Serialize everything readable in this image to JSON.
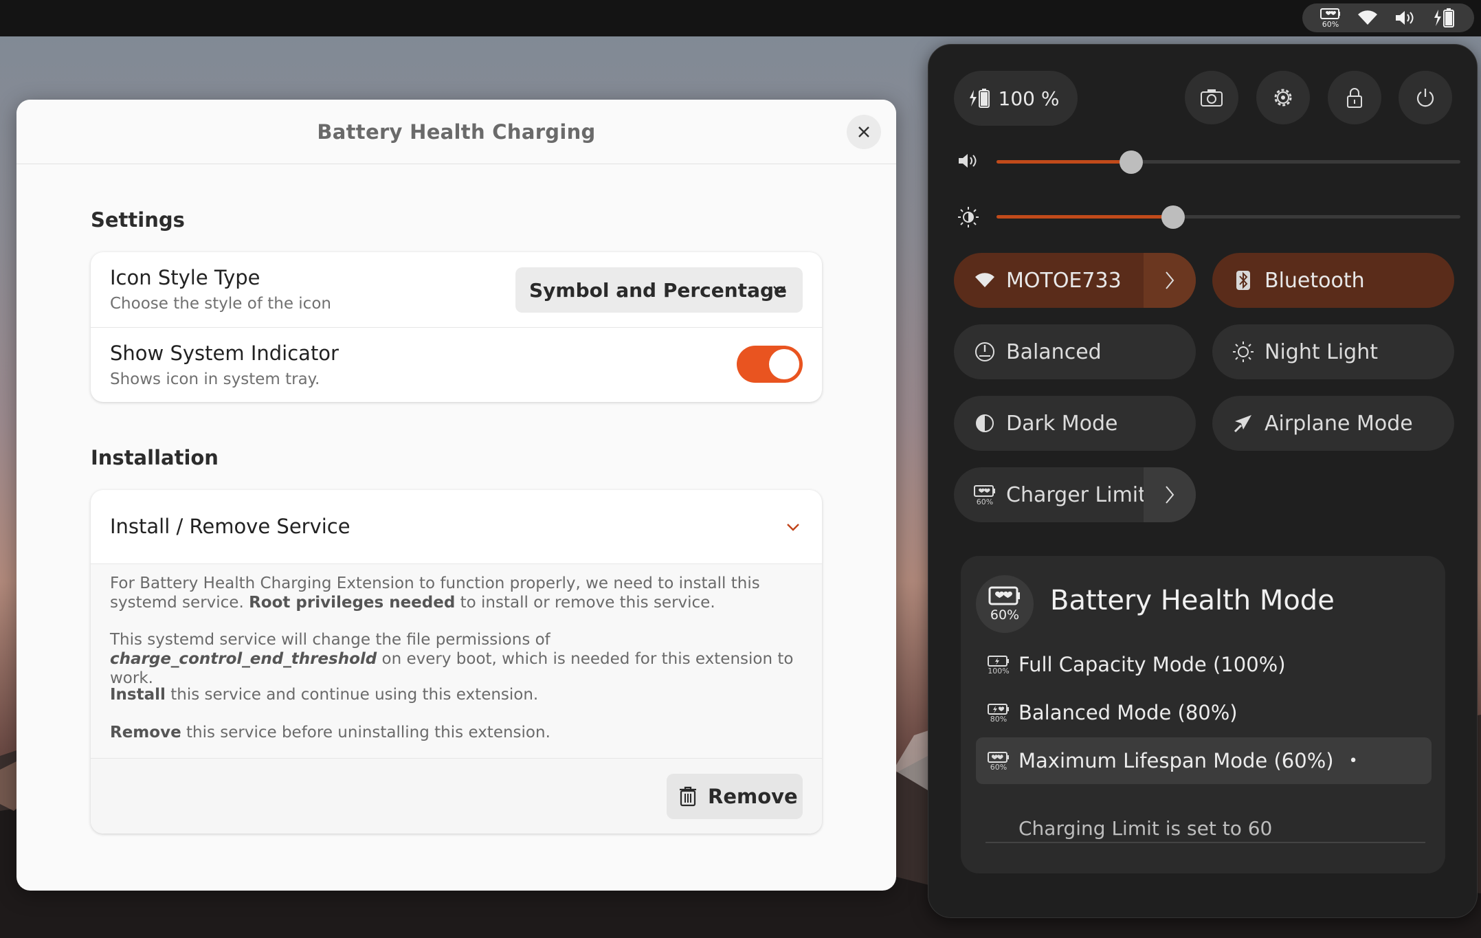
{
  "topbar": {
    "tray_battery_pct": "60%",
    "icons": [
      "battery-health-icon",
      "wifi-icon",
      "volume-icon",
      "battery-icon"
    ]
  },
  "dialog": {
    "title": "Battery Health Charging",
    "close_icon": "close-icon",
    "settings": {
      "heading": "Settings",
      "icon_style": {
        "title": "Icon Style Type",
        "subtitle": "Choose the style of the icon",
        "selected": "Symbol and Percentage"
      },
      "system_indicator": {
        "title": "Show System Indicator",
        "subtitle": "Shows icon in system tray.",
        "enabled": true
      }
    },
    "installation": {
      "heading": "Installation",
      "expander_title": "Install / Remove Service",
      "p1_a": "For Battery Health Charging Extension to function properly, we need to install this systemd service. ",
      "p1_bold": "Root privileges needed",
      "p1_b": " to install or remove this service.",
      "p2_a": "This systemd service will change the file permissions of ",
      "p2_code": "charge_control_end_threshold",
      "p2_b": " on every boot, which is needed for this extension to work.",
      "p3_bold": "Install",
      "p3_rest": " this service and continue using this extension.",
      "p4_bold": "Remove",
      "p4_rest": " this service before uninstalling this extension.",
      "remove_label": "Remove"
    }
  },
  "quick_settings": {
    "battery_label": "100 %",
    "round_buttons": [
      "screenshot-icon",
      "settings-icon",
      "lock-icon",
      "power-icon"
    ],
    "volume_level": 0.29,
    "brightness_level": 0.38,
    "tiles": {
      "wifi": "MOTOE733",
      "bluetooth": "Bluetooth",
      "power_mode": "Balanced",
      "night_light": "Night Light",
      "dark_mode": "Dark Mode",
      "airplane": "Airplane Mode",
      "charger_limit": "Charger Limit",
      "charger_limit_pct": "60%"
    },
    "battery_health": {
      "title": "Battery Health Mode",
      "icon_pct": "60%",
      "modes": [
        {
          "label": "Full Capacity Mode  (100%)",
          "icon_pct": "100%"
        },
        {
          "label": "Balanced Mode  (80%)",
          "icon_pct": "80%"
        },
        {
          "label": "Maximum Lifespan Mode  (60%)",
          "icon_pct": "60%",
          "selected_marker": "•"
        }
      ],
      "status": "Charging Limit is set to 60"
    },
    "accent_color": "#e95420"
  }
}
